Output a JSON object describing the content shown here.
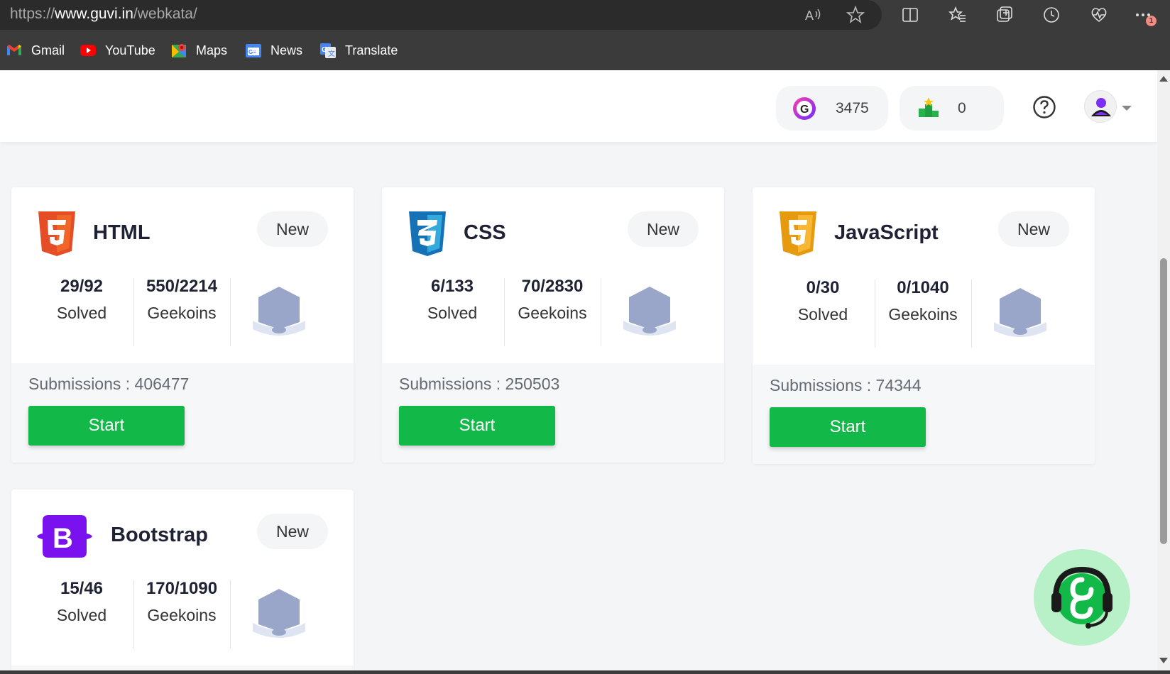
{
  "browser": {
    "url_prefix": "https://",
    "url_host": "www.guvi.in",
    "url_path": "/webkata/",
    "bookmarks": [
      {
        "label": "Gmail",
        "icon": "gmail-icon"
      },
      {
        "label": "YouTube",
        "icon": "youtube-icon"
      },
      {
        "label": "Maps",
        "icon": "maps-icon"
      },
      {
        "label": "News",
        "icon": "news-icon"
      },
      {
        "label": "Translate",
        "icon": "translate-icon"
      }
    ],
    "notification_badge": "1"
  },
  "header": {
    "geekoins": "3475",
    "rank": "0"
  },
  "cards": [
    {
      "title": "HTML",
      "badge": "New",
      "solved": "29/92",
      "solved_label": "Solved",
      "geekoins": "550/2214",
      "geekoins_label": "Geekoins",
      "submissions": "Submissions : 406477",
      "start": "Start",
      "color": "#e44d26"
    },
    {
      "title": "CSS",
      "badge": "New",
      "solved": "6/133",
      "solved_label": "Solved",
      "geekoins": "70/2830",
      "geekoins_label": "Geekoins",
      "submissions": "Submissions : 250503",
      "start": "Start",
      "color": "#1572b6"
    },
    {
      "title": "JavaScript",
      "badge": "New",
      "solved": "0/30",
      "solved_label": "Solved",
      "geekoins": "0/1040",
      "geekoins_label": "Geekoins",
      "submissions": "Submissions : 74344",
      "start": "Start",
      "color": "#f0a623"
    },
    {
      "title": "Bootstrap",
      "badge": "New",
      "solved": "15/46",
      "solved_label": "Solved",
      "geekoins": "170/1090",
      "geekoins_label": "Geekoins",
      "color": "#7a12f0"
    }
  ],
  "colors": {
    "accent_green": "#12b848",
    "page_bg": "#f4f5f7"
  }
}
